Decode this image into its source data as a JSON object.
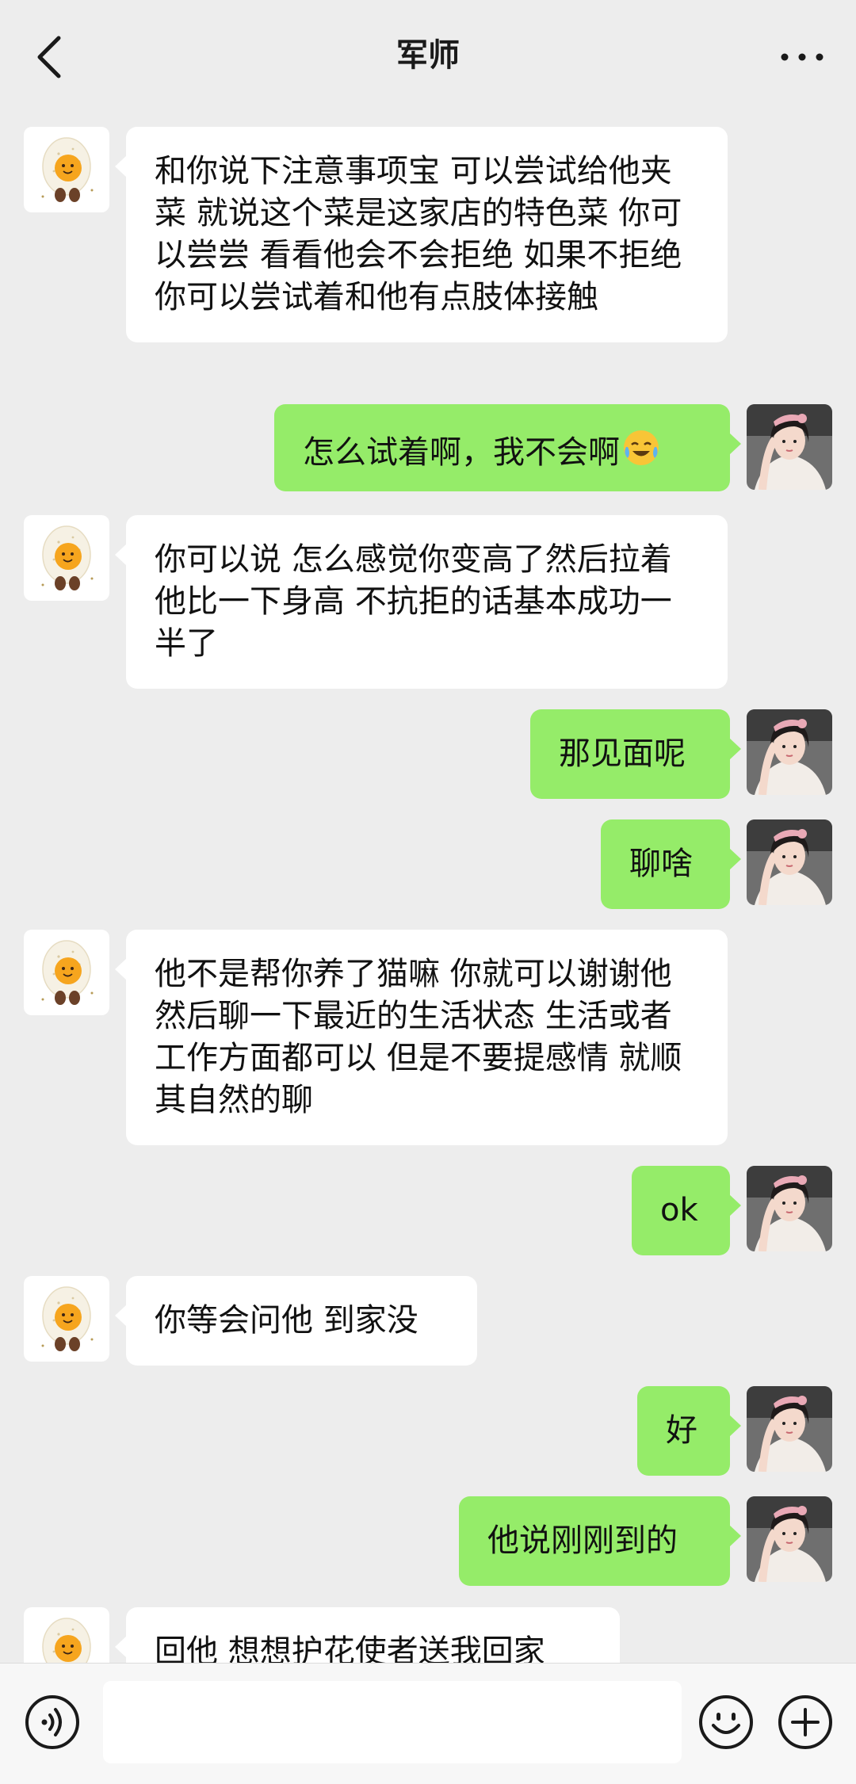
{
  "header": {
    "title": "军师",
    "back_icon": "chevron-left-icon",
    "more_icon": "more-dots-icon"
  },
  "colors": {
    "background": "#ededed",
    "outgoing_bubble": "#95ec69",
    "incoming_bubble": "#ffffff"
  },
  "messages": [
    {
      "side": "in",
      "text": "和你说下注意事项宝 可以尝试给他夹菜 就说这个菜是这家店的特色菜 你可以尝尝 看看他会不会拒绝 如果不拒绝 你可以尝试着和他有点肢体接触"
    },
    {
      "side": "out",
      "text": "怎么试着啊，我不会啊",
      "emoji": "laughing-crying-emoji"
    },
    {
      "side": "in",
      "text": "你可以说 怎么感觉你变高了然后拉着他比一下身高 不抗拒的话基本成功一半了"
    },
    {
      "side": "out",
      "text": "那见面呢"
    },
    {
      "side": "out",
      "text": "聊啥"
    },
    {
      "side": "in",
      "text": "他不是帮你养了猫嘛 你就可以谢谢他 然后聊一下最近的生活状态 生活或者工作方面都可以 但是不要提感情 就顺其自然的聊"
    },
    {
      "side": "out",
      "text": "ok"
    },
    {
      "side": "in",
      "text": "你等会问他 到家没"
    },
    {
      "side": "out",
      "text": "好"
    },
    {
      "side": "out",
      "text": "他说刚刚到的"
    },
    {
      "side": "in",
      "text": "回他 想想护花使者送我回家"
    }
  ],
  "footer": {
    "voice_icon": "voice-icon",
    "input_value": "",
    "emoji_icon": "emoji-icon",
    "plus_icon": "plus-icon"
  }
}
